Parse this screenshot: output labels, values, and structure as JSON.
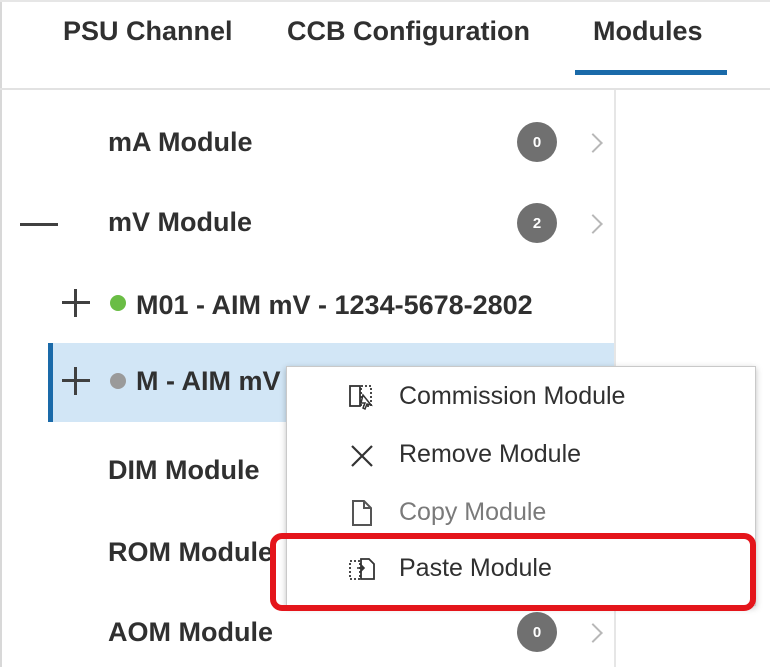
{
  "tabs": [
    {
      "label": "PSU Channel"
    },
    {
      "label": "CCB Configuration"
    },
    {
      "label": "Modules",
      "active": true
    }
  ],
  "modules": [
    {
      "label": "mA Module",
      "count": "0",
      "expanded": false
    },
    {
      "label": "mV Module",
      "count": "2",
      "expanded": true
    },
    {
      "label": "DIM Module"
    },
    {
      "label": "ROM Module"
    },
    {
      "label": "AOM Module",
      "count": "0"
    }
  ],
  "mv_children": [
    {
      "label": "M01 - AIM mV - 1234-5678-2802",
      "status_color": "#6abd45"
    },
    {
      "label": "M - AIM mV",
      "status_color": "#9a9a9a",
      "selected": true
    }
  ],
  "context_menu": {
    "items": [
      {
        "label": "Commission Module",
        "icon": "commission-icon",
        "enabled": true
      },
      {
        "label": "Remove Module",
        "icon": "close-icon",
        "enabled": true
      },
      {
        "label": "Copy Module",
        "icon": "copy-icon",
        "enabled": false
      },
      {
        "label": "Paste Module",
        "icon": "paste-icon",
        "enabled": true,
        "highlighted": true
      }
    ]
  },
  "colors": {
    "accent": "#1a6aa9",
    "selection": "#d2e6f6",
    "highlight": "#e4151b",
    "badge": "#707070"
  }
}
